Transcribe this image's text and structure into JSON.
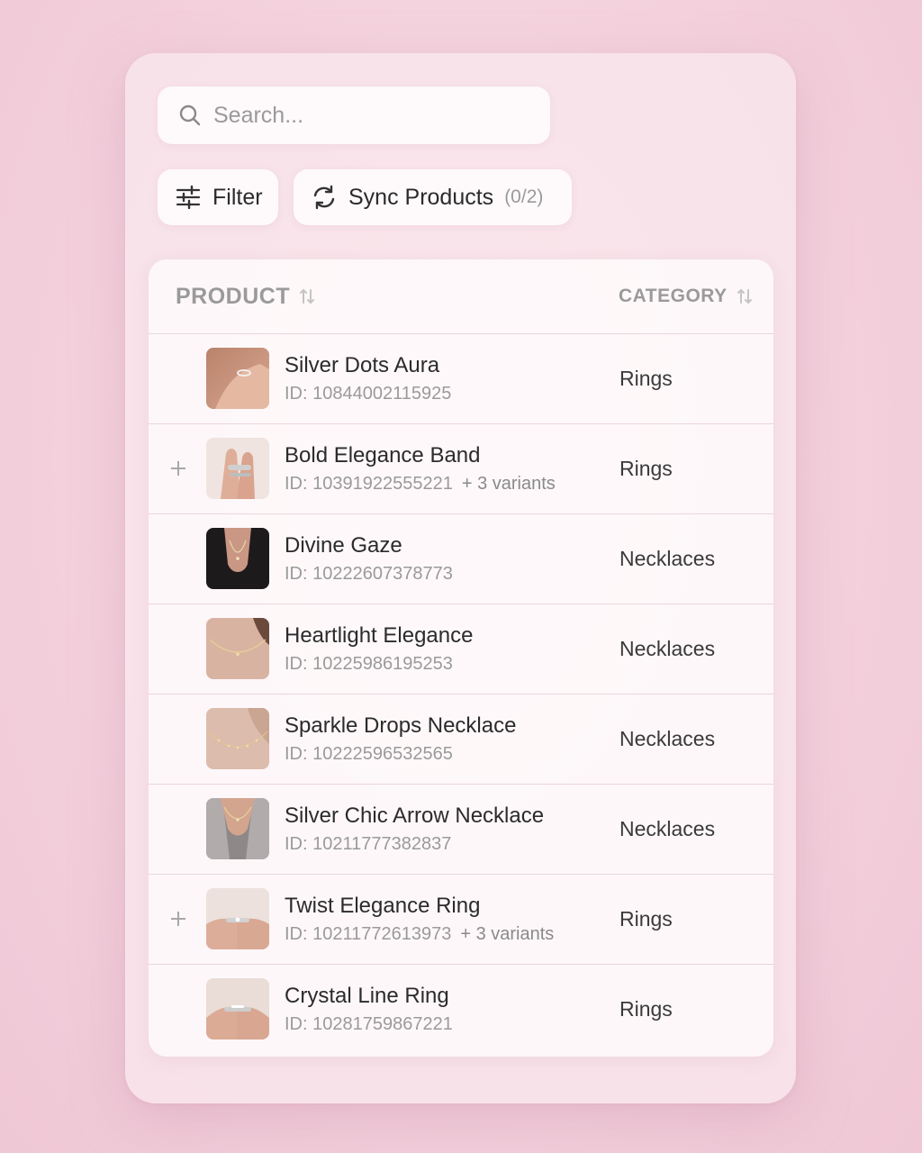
{
  "search": {
    "placeholder": "Search..."
  },
  "toolbar": {
    "filter_label": "Filter",
    "sync_label": "Sync Products",
    "sync_count": "(0/2)"
  },
  "table": {
    "columns": {
      "product": "PRODUCT",
      "category": "CATEGORY"
    },
    "rows": [
      {
        "name": "Silver Dots Aura",
        "id": "ID: 10844002115925",
        "variants": "",
        "category": "Rings",
        "expandable": false,
        "thumb": "ring-hand"
      },
      {
        "name": "Bold Elegance Band",
        "id": "ID: 10391922555221",
        "variants": "+ 3 variants",
        "category": "Rings",
        "expandable": true,
        "thumb": "ring-fingers"
      },
      {
        "name": "Divine Gaze",
        "id": "ID: 10222607378773",
        "variants": "",
        "category": "Necklaces",
        "expandable": false,
        "thumb": "necklace-dark"
      },
      {
        "name": "Heartlight Elegance",
        "id": "ID: 10225986195253",
        "variants": "",
        "category": "Necklaces",
        "expandable": false,
        "thumb": "necklace-skin"
      },
      {
        "name": "Sparkle Drops Necklace",
        "id": "ID: 10222596532565",
        "variants": "",
        "category": "Necklaces",
        "expandable": false,
        "thumb": "necklace-skin"
      },
      {
        "name": "Silver Chic Arrow Necklace",
        "id": "ID: 10211777382837",
        "variants": "",
        "category": "Necklaces",
        "expandable": false,
        "thumb": "necklace-grey"
      },
      {
        "name": "Twist Elegance Ring",
        "id": "ID: 10211772613973",
        "variants": "+ 3 variants",
        "category": "Rings",
        "expandable": true,
        "thumb": "ring-pinch"
      },
      {
        "name": "Crystal Line Ring",
        "id": "ID: 10281759867221",
        "variants": "",
        "category": "Rings",
        "expandable": false,
        "thumb": "ring-pinch"
      }
    ]
  },
  "colors": {
    "background": "#f3d0dc",
    "muted_text": "#9a9a9a",
    "primary_text": "#2b2b2b"
  },
  "icons": {
    "search": "search-icon",
    "filter": "sliders-icon",
    "sync": "refresh-icon",
    "sort": "sort-arrows-icon",
    "expand": "plus-icon"
  }
}
